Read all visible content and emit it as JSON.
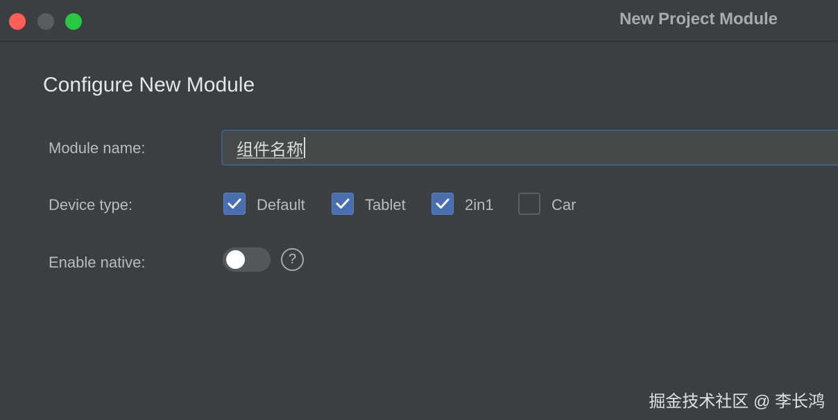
{
  "window": {
    "title": "New Project Module"
  },
  "heading": "Configure New Module",
  "module_name": {
    "label": "Module name:",
    "value": "组件名称"
  },
  "device_type": {
    "label": "Device type:",
    "options": [
      {
        "label": "Default",
        "checked": true
      },
      {
        "label": "Tablet",
        "checked": true
      },
      {
        "label": "2in1",
        "checked": true
      },
      {
        "label": "Car",
        "checked": false
      }
    ]
  },
  "enable_native": {
    "label": "Enable native:",
    "enabled": false,
    "help_symbol": "?"
  },
  "watermark": "掘金技术社区 @ 李长鸿",
  "colors": {
    "background": "#3c3f41",
    "accent": "#4a6fb0",
    "focus_border": "#3d6185",
    "close": "#ff5f57",
    "zoom": "#28c840"
  },
  "icons": [
    "close-icon",
    "minimize-icon",
    "zoom-icon",
    "check-icon",
    "help-icon"
  ]
}
